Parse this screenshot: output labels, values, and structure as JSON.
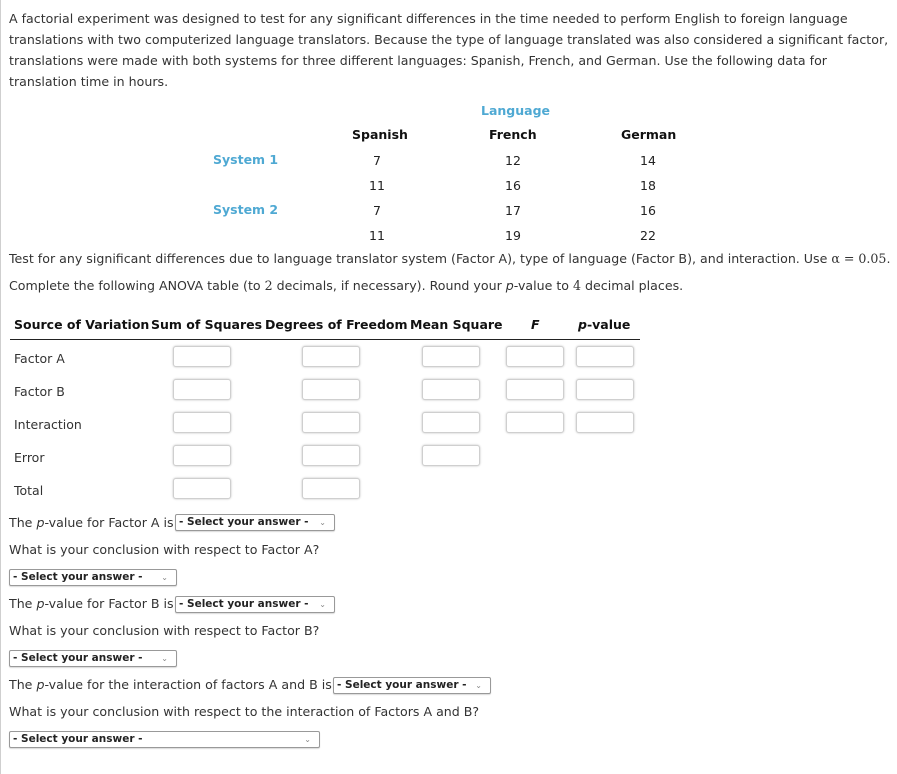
{
  "intro": "A factorial experiment was designed to test for any significant differences in the time needed to perform English to foreign language translations with two computerized language translators. Because the type of language translated was also considered a significant factor, translations were made with both systems for three different languages: Spanish, French, and German. Use the following data for translation time in hours.",
  "data_table": {
    "column_group": "Language",
    "columns": [
      "Spanish",
      "French",
      "German"
    ],
    "rows": [
      {
        "system": "System 1",
        "values": [
          [
            "7",
            "12",
            "14"
          ],
          [
            "11",
            "16",
            "18"
          ]
        ]
      },
      {
        "system": "System 2",
        "values": [
          [
            "7",
            "17",
            "16"
          ],
          [
            "11",
            "19",
            "22"
          ]
        ]
      }
    ]
  },
  "instructions": {
    "line1_pre": "Test for any significant differences due to language translator system (Factor A), type of language (Factor B), and interaction. Use ",
    "alpha": "α = 0.05",
    "line1_post": ".",
    "line2_pre": "Complete the following ANOVA table (to ",
    "decimals": "2",
    "line2_mid": " decimals, if necessary). Round your ",
    "pvalue_italic": "p",
    "line2_mid2": "-value to ",
    "pdecimals": "4",
    "line2_post": " decimal places."
  },
  "anova": {
    "headers": [
      "Source of Variation",
      "Sum of Squares",
      "Degrees of Freedom",
      "Mean Square",
      "F",
      "p-value"
    ],
    "rows": [
      "Factor A",
      "Factor B",
      "Interaction",
      "Error",
      "Total"
    ]
  },
  "questions": {
    "select_placeholder": "- Select your answer -",
    "q_pA_pre": "The ",
    "p": "p",
    "q_pA_post": "-value for Factor A is",
    "q_concA": "What is your conclusion with respect to Factor A?",
    "q_pB_post": "-value for Factor B is",
    "q_concB": "What is your conclusion with respect to Factor B?",
    "q_pAB_post": "-value for the interaction of factors A and B is",
    "q_concAB": "What is your conclusion with respect to the interaction of Factors A and B?"
  }
}
